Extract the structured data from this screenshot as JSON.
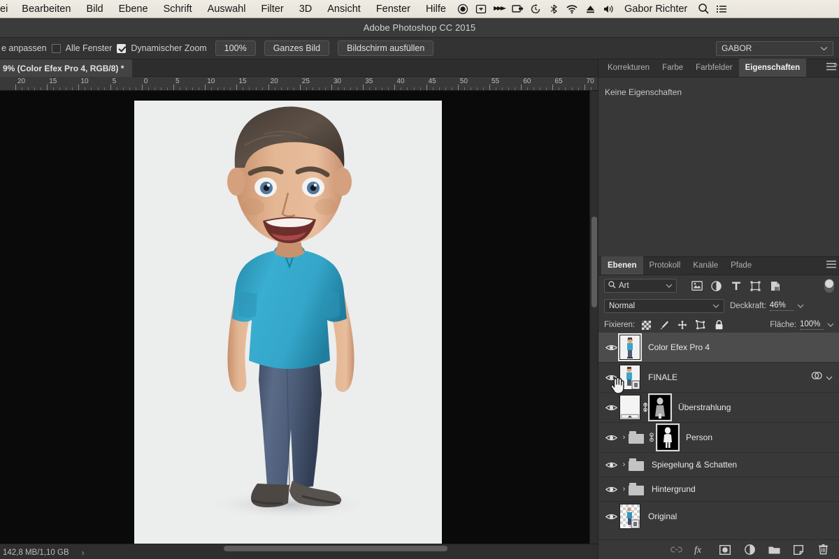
{
  "macmenu": {
    "items": [
      "ei",
      "Bearbeiten",
      "Bild",
      "Ebene",
      "Schrift",
      "Auswahl",
      "Filter",
      "3D",
      "Ansicht",
      "Fenster",
      "Hilfe"
    ],
    "status_icons": [
      "record-icon",
      "airplay-icon",
      "fastforward-icon",
      "screenshare-icon",
      "timemachine-icon",
      "bluetooth-icon",
      "wifi-icon",
      "eject-icon",
      "volume-icon"
    ],
    "username": "Gabor Richter",
    "search_icon": "search-icon",
    "notification_icon": "notification-center-icon"
  },
  "titlebar": {
    "title": "Adobe Photoshop CC 2015"
  },
  "options_bar": {
    "resize_windows_label": "e anpassen",
    "all_windows_label": "Alle Fenster",
    "all_windows_checked": false,
    "scrubby_zoom_label": "Dynamischer Zoom",
    "scrubby_zoom_checked": true,
    "zoom_100_label": "100%",
    "fit_screen_label": "Ganzes Bild",
    "fill_screen_label": "Bildschirm ausfüllen",
    "workspace_name": "GABOR"
  },
  "document": {
    "tab_label": "9% (Color Efex Pro 4, RGB/8) *",
    "ruler_labels": [
      "20",
      "15",
      "10",
      "5",
      "0",
      "5",
      "10",
      "15",
      "20",
      "25",
      "30",
      "35",
      "40",
      "45",
      "50",
      "55",
      "60",
      "65",
      "70"
    ]
  },
  "status": {
    "memory": "142,8 MB/1,10 GB",
    "expand_icon": "chevron-right-icon"
  },
  "properties_panel": {
    "tabs": [
      {
        "label": "Korrekturen",
        "active": false
      },
      {
        "label": "Farbe",
        "active": false
      },
      {
        "label": "Farbfelder",
        "active": false
      },
      {
        "label": "Eigenschaften",
        "active": true
      }
    ],
    "menu_icon": "panel-menu-icon",
    "empty_text": "Keine Eigenschaften"
  },
  "layers_panel": {
    "tabs": [
      {
        "label": "Ebenen",
        "active": true
      },
      {
        "label": "Protokoll",
        "active": false
      },
      {
        "label": "Kanäle",
        "active": false
      },
      {
        "label": "Pfade",
        "active": false
      }
    ],
    "menu_icon": "panel-menu-icon",
    "filter": {
      "kind_label": "Art",
      "search_icon": "search-icon",
      "chevron_icon": "chevron-down-icon",
      "type_filters": [
        "pixel-layer-icon",
        "adjustment-layer-icon",
        "text-layer-icon",
        "shape-layer-icon",
        "smart-object-icon"
      ],
      "toggle_icon": "filter-toggle-switch"
    },
    "blend_mode": "Normal",
    "opacity_label": "Deckkraft:",
    "opacity_value": "46%",
    "lock_label": "Fixieren:",
    "lock_icons": [
      "lock-transparency-icon",
      "lock-image-icon",
      "lock-position-icon",
      "lock-artboard-icon",
      "lock-all-icon"
    ],
    "fill_label": "Fläche:",
    "fill_value": "100%",
    "layers": [
      {
        "name": "Color Efex Pro 4",
        "visible": true,
        "selected": true,
        "type": "smart",
        "has_thumb": true,
        "framed": true,
        "group": false,
        "mask": false,
        "link": false,
        "right_icon": ""
      },
      {
        "name": "FINALE",
        "visible": true,
        "selected": false,
        "type": "smart",
        "has_thumb": true,
        "framed": false,
        "group": false,
        "mask": false,
        "link": false,
        "right_icon": "layer-effects-icon",
        "cursor_over_eye": true
      },
      {
        "name": "Überstrahlung",
        "visible": true,
        "selected": false,
        "type": "adjustment",
        "has_thumb": true,
        "framed": false,
        "group": false,
        "mask": true,
        "link": true,
        "right_icon": ""
      },
      {
        "name": "Person",
        "visible": true,
        "selected": false,
        "type": "group",
        "has_thumb": false,
        "framed": false,
        "group": true,
        "mask": true,
        "link": true,
        "right_icon": ""
      },
      {
        "name": "Spiegelung & Schatten",
        "visible": true,
        "selected": false,
        "type": "group",
        "has_thumb": false,
        "framed": false,
        "group": true,
        "mask": false,
        "link": false,
        "right_icon": ""
      },
      {
        "name": "Hintergrund",
        "visible": true,
        "selected": false,
        "type": "group",
        "has_thumb": false,
        "framed": false,
        "group": true,
        "mask": false,
        "link": false,
        "right_icon": ""
      },
      {
        "name": "Original",
        "visible": true,
        "selected": false,
        "type": "smart",
        "has_thumb": true,
        "framed": false,
        "group": false,
        "mask": false,
        "link": false,
        "right_icon": ""
      }
    ],
    "footer_buttons": [
      "link-layers-icon",
      "layer-style-fx-icon",
      "add-mask-icon",
      "adjustment-layer-icon",
      "new-group-icon",
      "new-layer-icon",
      "delete-layer-icon"
    ]
  },
  "colors": {
    "menubar_bg": "#eae7de",
    "panel_bg": "#383838",
    "canvas_bg": "#0a0a0a",
    "sheet_bg": "#eceded",
    "shirt": "#33a9cc",
    "jeans": "#4a5a74",
    "skin": "#dcaf8c",
    "hair": "#4a4038",
    "selected_row": "#4c4c4c"
  }
}
